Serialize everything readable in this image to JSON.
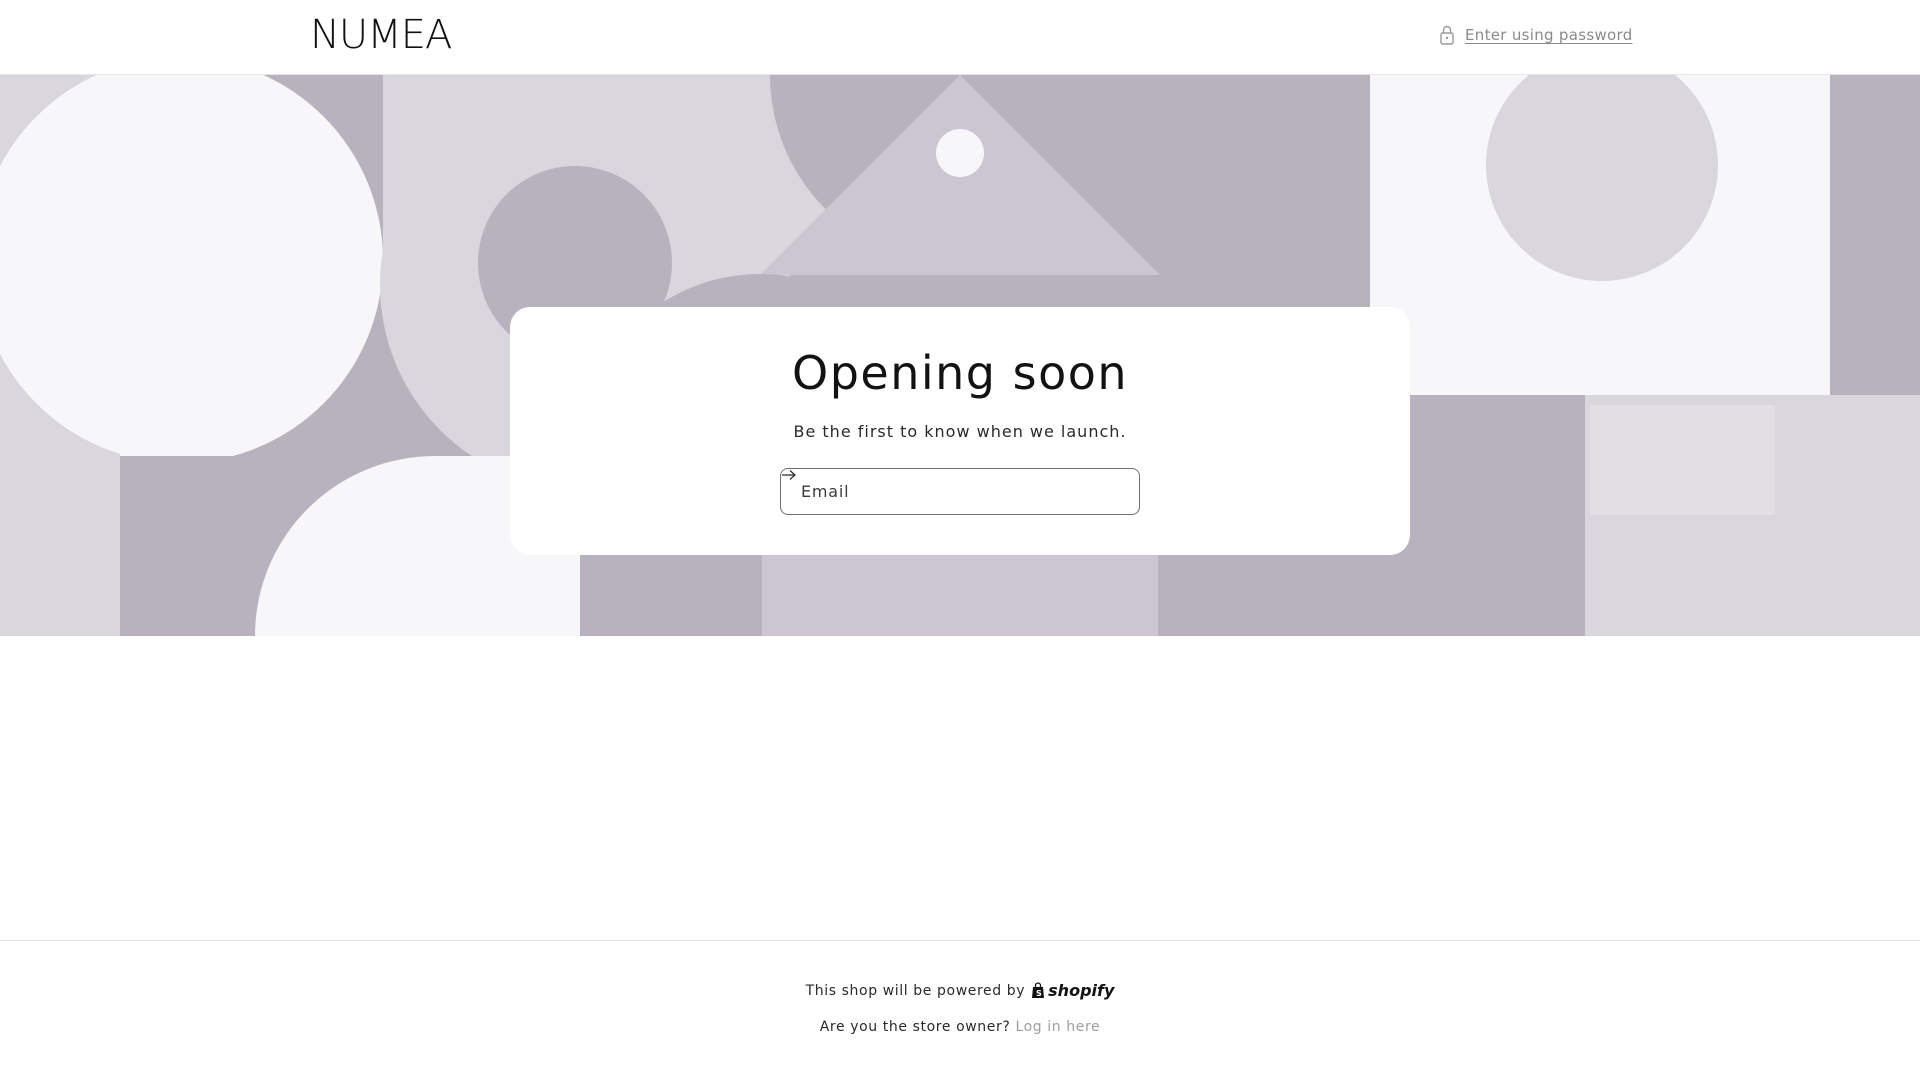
{
  "header": {
    "logo": "NUMEA",
    "password_link": "Enter using password",
    "password_icon": "lock-icon"
  },
  "hero": {
    "title": "Opening soon",
    "subtitle": "Be the first to know when we launch.",
    "email_placeholder": "Email",
    "submit_icon": "arrow-right-icon"
  },
  "footer": {
    "powered_text": "This shop will be powered by",
    "powered_brand": "shopify",
    "owner_question": "Are you the store owner?",
    "login_link": "Log in here"
  },
  "colors": {
    "banner_dark": "#b8b2bf",
    "banner_mid": "#cbc6d1",
    "banner_light": "#d9d7dd",
    "banner_pale": "#f7f7f9",
    "text": "#121212",
    "muted": "#8a8a8a"
  }
}
